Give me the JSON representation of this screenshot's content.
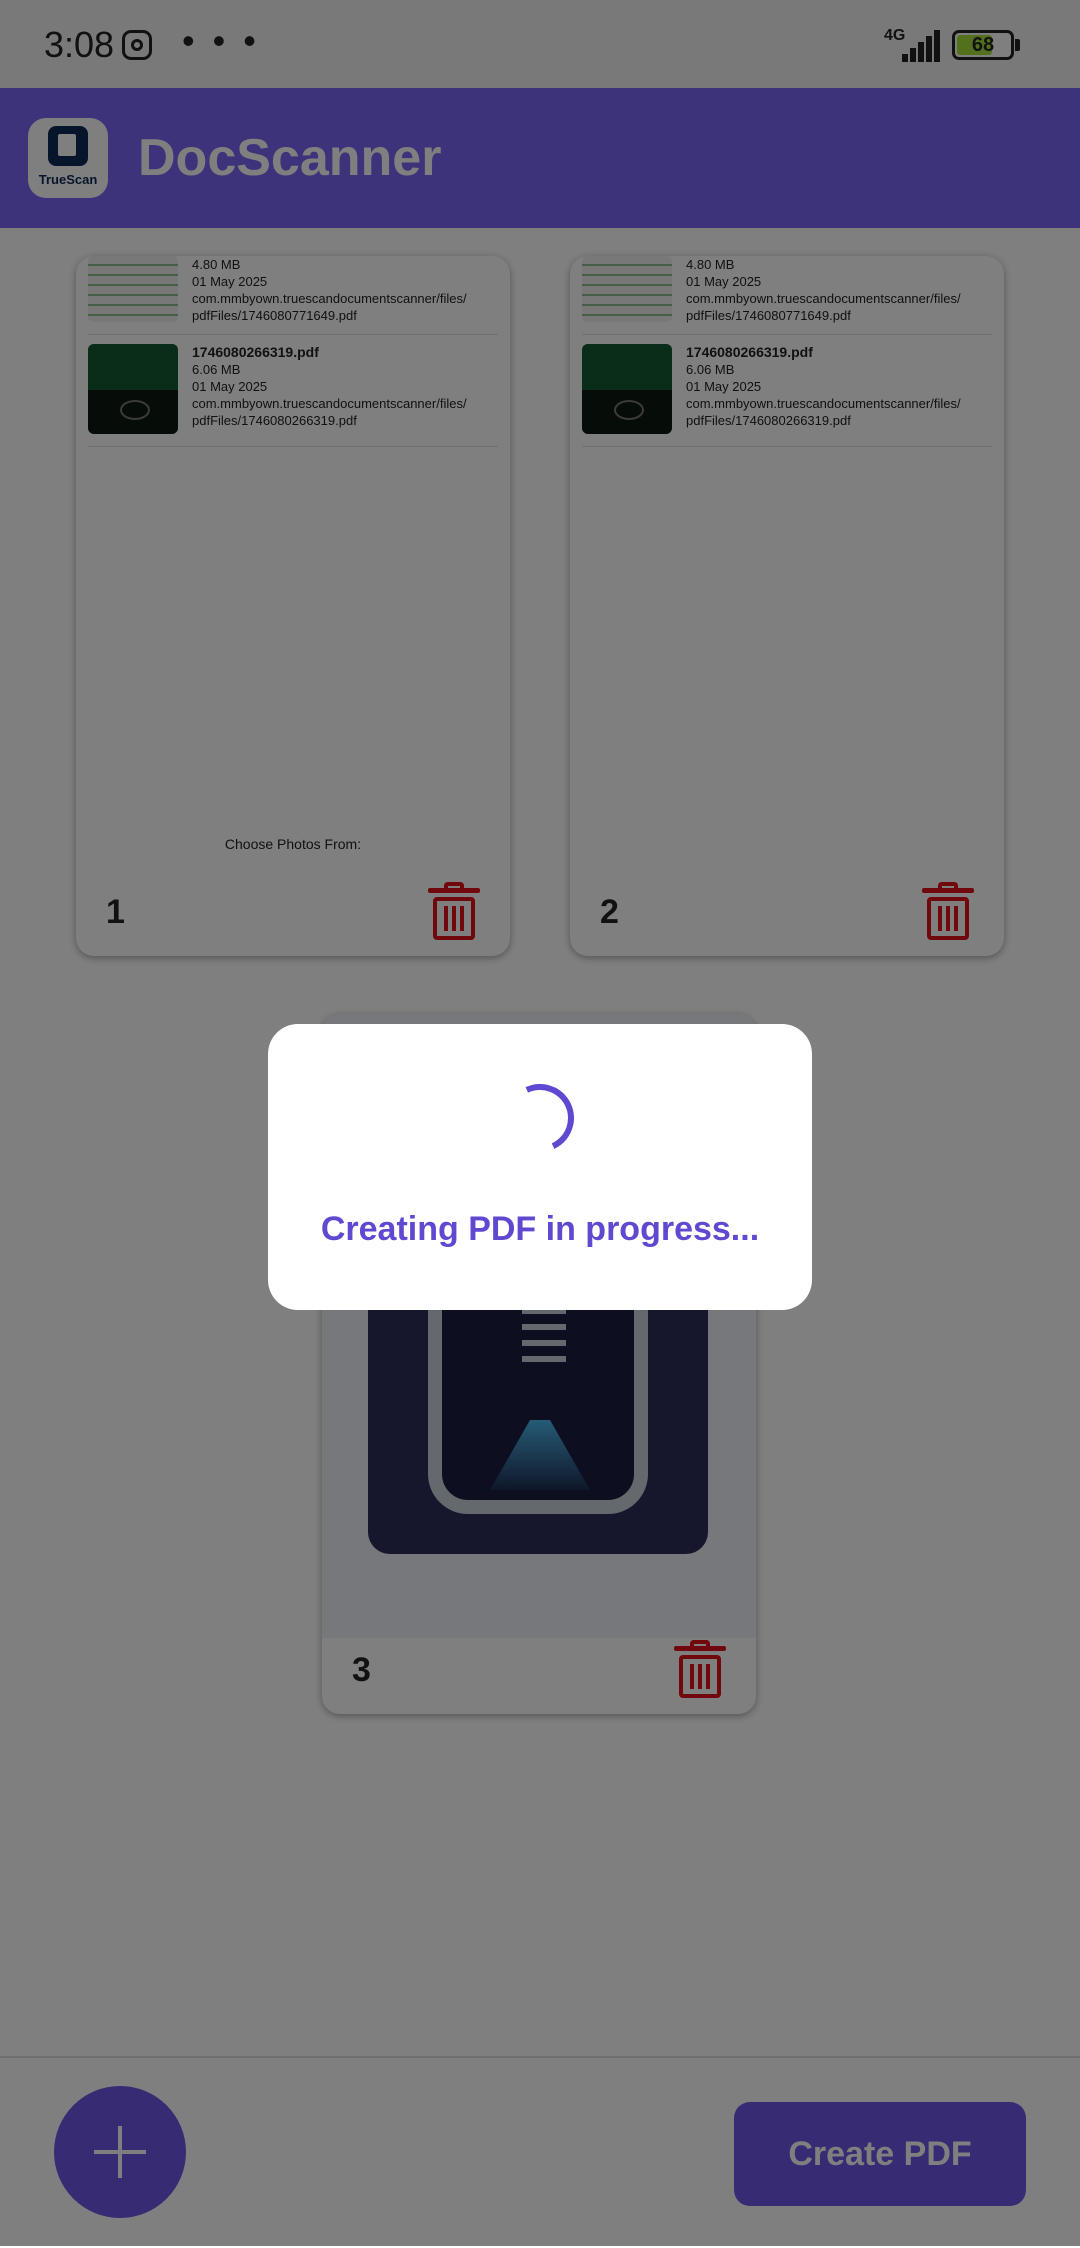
{
  "status_bar": {
    "time": "3:08",
    "overflow": "• • •",
    "network": "4G",
    "battery": "68",
    "battery_level": 0.68
  },
  "app_bar": {
    "logo_text": "TrueScan",
    "title": "DocScanner"
  },
  "pages": [
    {
      "number": "1",
      "items": [
        {
          "size": "4.80 MB",
          "date": "01 May 2025",
          "path_line1": "com.mmbyown.truescandocumentscanner/files/",
          "path_line2": "pdfFiles/1746080771649.pdf"
        },
        {
          "name": "1746080266319.pdf",
          "size": "6.06 MB",
          "date": "01 May 2025",
          "path_line1": "com.mmbyown.truescandocumentscanner/files/",
          "path_line2": "pdfFiles/1746080266319.pdf"
        }
      ],
      "footer_text": "Choose Photos From:"
    },
    {
      "number": "2",
      "items": [
        {
          "size": "4.80 MB",
          "date": "01 May 2025",
          "path_line1": "com.mmbyown.truescandocumentscanner/files/",
          "path_line2": "pdfFiles/1746080771649.pdf"
        },
        {
          "name": "1746080266319.pdf",
          "size": "6.06 MB",
          "date": "01 May 2025",
          "path_line1": "com.mmbyown.truescandocumentscanner/files/",
          "path_line2": "pdfFiles/1746080266319.pdf"
        }
      ]
    },
    {
      "number": "3"
    }
  ],
  "bottom_bar": {
    "add_icon": "plus-icon",
    "create_label": "Create PDF"
  },
  "dialog": {
    "message": "Creating PDF in progress..."
  },
  "colors": {
    "primary": "#7b66f5",
    "accent_text": "#6048d0",
    "delete": "#e0101a"
  }
}
